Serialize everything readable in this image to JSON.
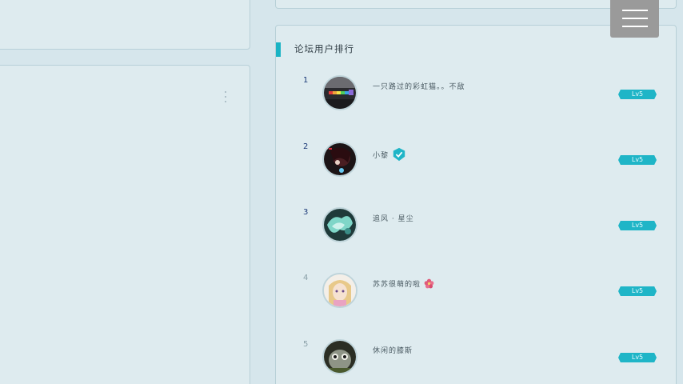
{
  "ranking": {
    "title": "论坛用户排行",
    "users": [
      {
        "rank": "1",
        "name": "一只路过的彩虹猫。。不敌",
        "level": "Lv5",
        "verified": false,
        "flower": false
      },
      {
        "rank": "2",
        "name": "小黎",
        "level": "Lv5",
        "verified": true,
        "flower": false
      },
      {
        "rank": "3",
        "name": "追风 · 星尘",
        "level": "Lv5",
        "verified": false,
        "flower": false
      },
      {
        "rank": "4",
        "name": "苏苏很萌的啦",
        "level": "Lv5",
        "verified": false,
        "flower": true
      },
      {
        "rank": "5",
        "name": "休闲的膝斯",
        "level": "Lv5",
        "verified": false,
        "flower": false
      }
    ]
  },
  "icons": {
    "menu": "hamburger-menu-icon",
    "more": "vertical-ellipsis-icon",
    "verified": "verified-shield-icon",
    "flower": "flower-icon"
  },
  "colors": {
    "background": "#d6e6ec",
    "panel": "#deebef",
    "accent": "#1ab3c4",
    "badge": "#1fb5c7",
    "menu_button": "#9a9a9a",
    "top_rank_number": "#1c3a78",
    "rank_number": "#8aa0a8"
  }
}
